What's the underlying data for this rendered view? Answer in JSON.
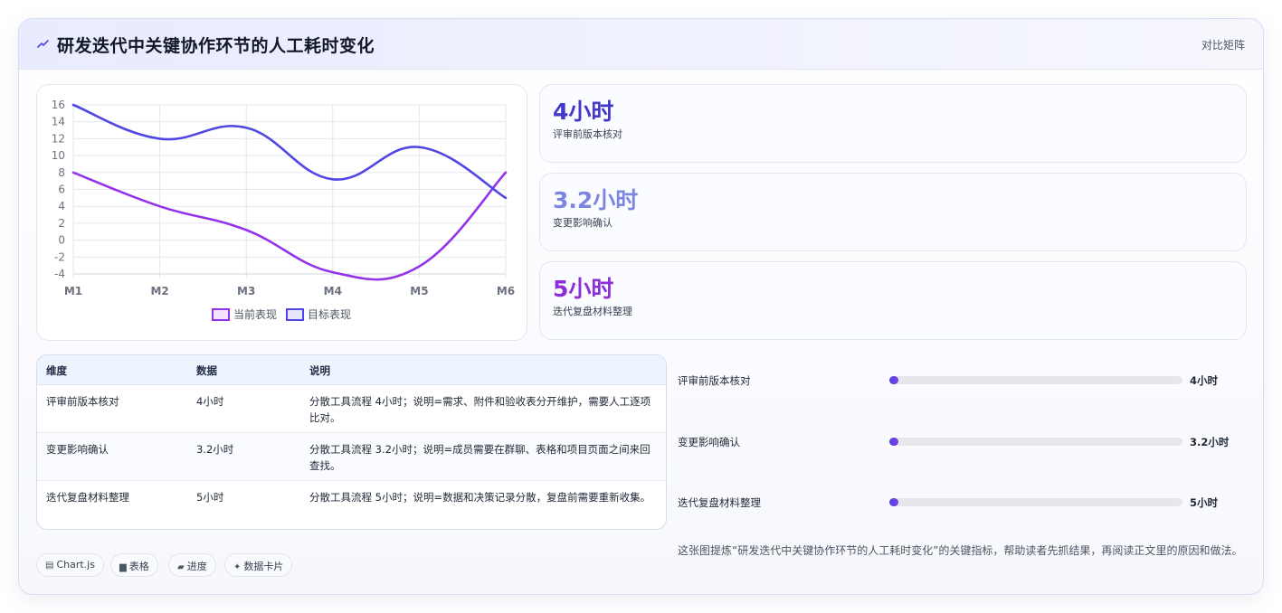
{
  "header": {
    "icon": "trend-icon",
    "title": "研发迭代中关键协作环节的人工耗时变化",
    "right_label": "对比矩阵"
  },
  "chart_data": {
    "type": "line",
    "categories": [
      "M1",
      "M2",
      "M3",
      "M4",
      "M5",
      "M6"
    ],
    "series": [
      {
        "name": "当前表现",
        "color": "#9333ea",
        "values": [
          8,
          4,
          1.2,
          -3.8,
          -3.1,
          8
        ]
      },
      {
        "name": "目标表现",
        "color": "#4f46e5",
        "values": [
          16,
          12,
          13.3,
          7.2,
          11,
          5
        ]
      }
    ],
    "y_ticks": [
      "16",
      "14",
      "12",
      "10",
      "8",
      "6",
      "4",
      "2",
      "0",
      "-2",
      "-4"
    ],
    "ylim": [
      -4,
      16
    ],
    "grid": true,
    "legend_position": "bottom"
  },
  "stats": [
    {
      "value": "4小时",
      "label": "评审前版本核对",
      "color": "#4338ca"
    },
    {
      "value": "3.2小时",
      "label": "变更影响确认",
      "color": "#7c86e0"
    },
    {
      "value": "5小时",
      "label": "迭代复盘材料整理",
      "color": "#8b2fd6"
    }
  ],
  "table": {
    "headers": [
      "维度",
      "数据",
      "说明"
    ],
    "rows": [
      {
        "dim": "评审前版本核对",
        "data": "4小时",
        "desc": "分散工具流程 4小时；说明=需求、附件和验收表分开维护，需要人工逐项比对。"
      },
      {
        "dim": "变更影响确认",
        "data": "3.2小时",
        "desc": "分散工具流程 3.2小时；说明=成员需要在群聊、表格和项目页面之间来回查找。"
      },
      {
        "dim": "迭代复盘材料整理",
        "data": "5小时",
        "desc": "分散工具流程 5小时；说明=数据和决策记录分散，复盘前需要重新收集。"
      }
    ]
  },
  "progress": [
    {
      "label": "评审前版本核对",
      "value": "4小时",
      "fraction": 0
    },
    {
      "label": "变更影响确认",
      "value": "3.2小时",
      "fraction": 0
    },
    {
      "label": "迭代复盘材料整理",
      "value": "5小时",
      "fraction": 0
    }
  ],
  "chips": [
    {
      "icon": "▤",
      "label": "Chart.js"
    },
    {
      "icon": "▆",
      "label": "表格"
    },
    {
      "icon": "▰",
      "label": "进度"
    },
    {
      "icon": "✦",
      "label": "数据卡片"
    }
  ],
  "footnote": "这张图提炼“研发迭代中关键协作环节的人工耗时变化”的关键指标，帮助读者先抓结果，再阅读正文里的原因和做法。"
}
